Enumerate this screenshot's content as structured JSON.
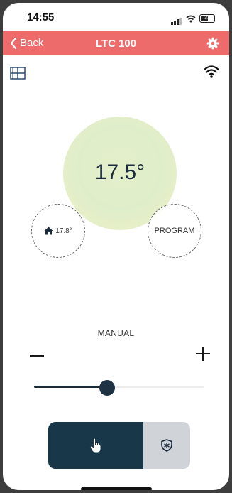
{
  "status_bar": {
    "time": "14:55",
    "battery_level": "33"
  },
  "navbar": {
    "back_label": "Back",
    "title": "LTC 100",
    "icons": {
      "back": "chevron-left-icon",
      "settings": "gear-icon"
    }
  },
  "toolbar": {
    "icons": {
      "left": "window-grid-icon",
      "right": "wifi-icon"
    }
  },
  "thermostat": {
    "setpoint": "17.5°",
    "room_temperature": "17.8°",
    "program_label": "PROGRAM",
    "mode_label": "MANUAL",
    "slider_level": 0.43
  },
  "mode_toggle": {
    "selected": "manual",
    "icons": {
      "manual": "hand-pointer-icon",
      "frost": "snowflake-shield-icon"
    }
  },
  "colors": {
    "accent": "#ee6b6c",
    "dark": "#18384a",
    "inactive": "#d0d3d8",
    "circle": "#e4efc9"
  }
}
